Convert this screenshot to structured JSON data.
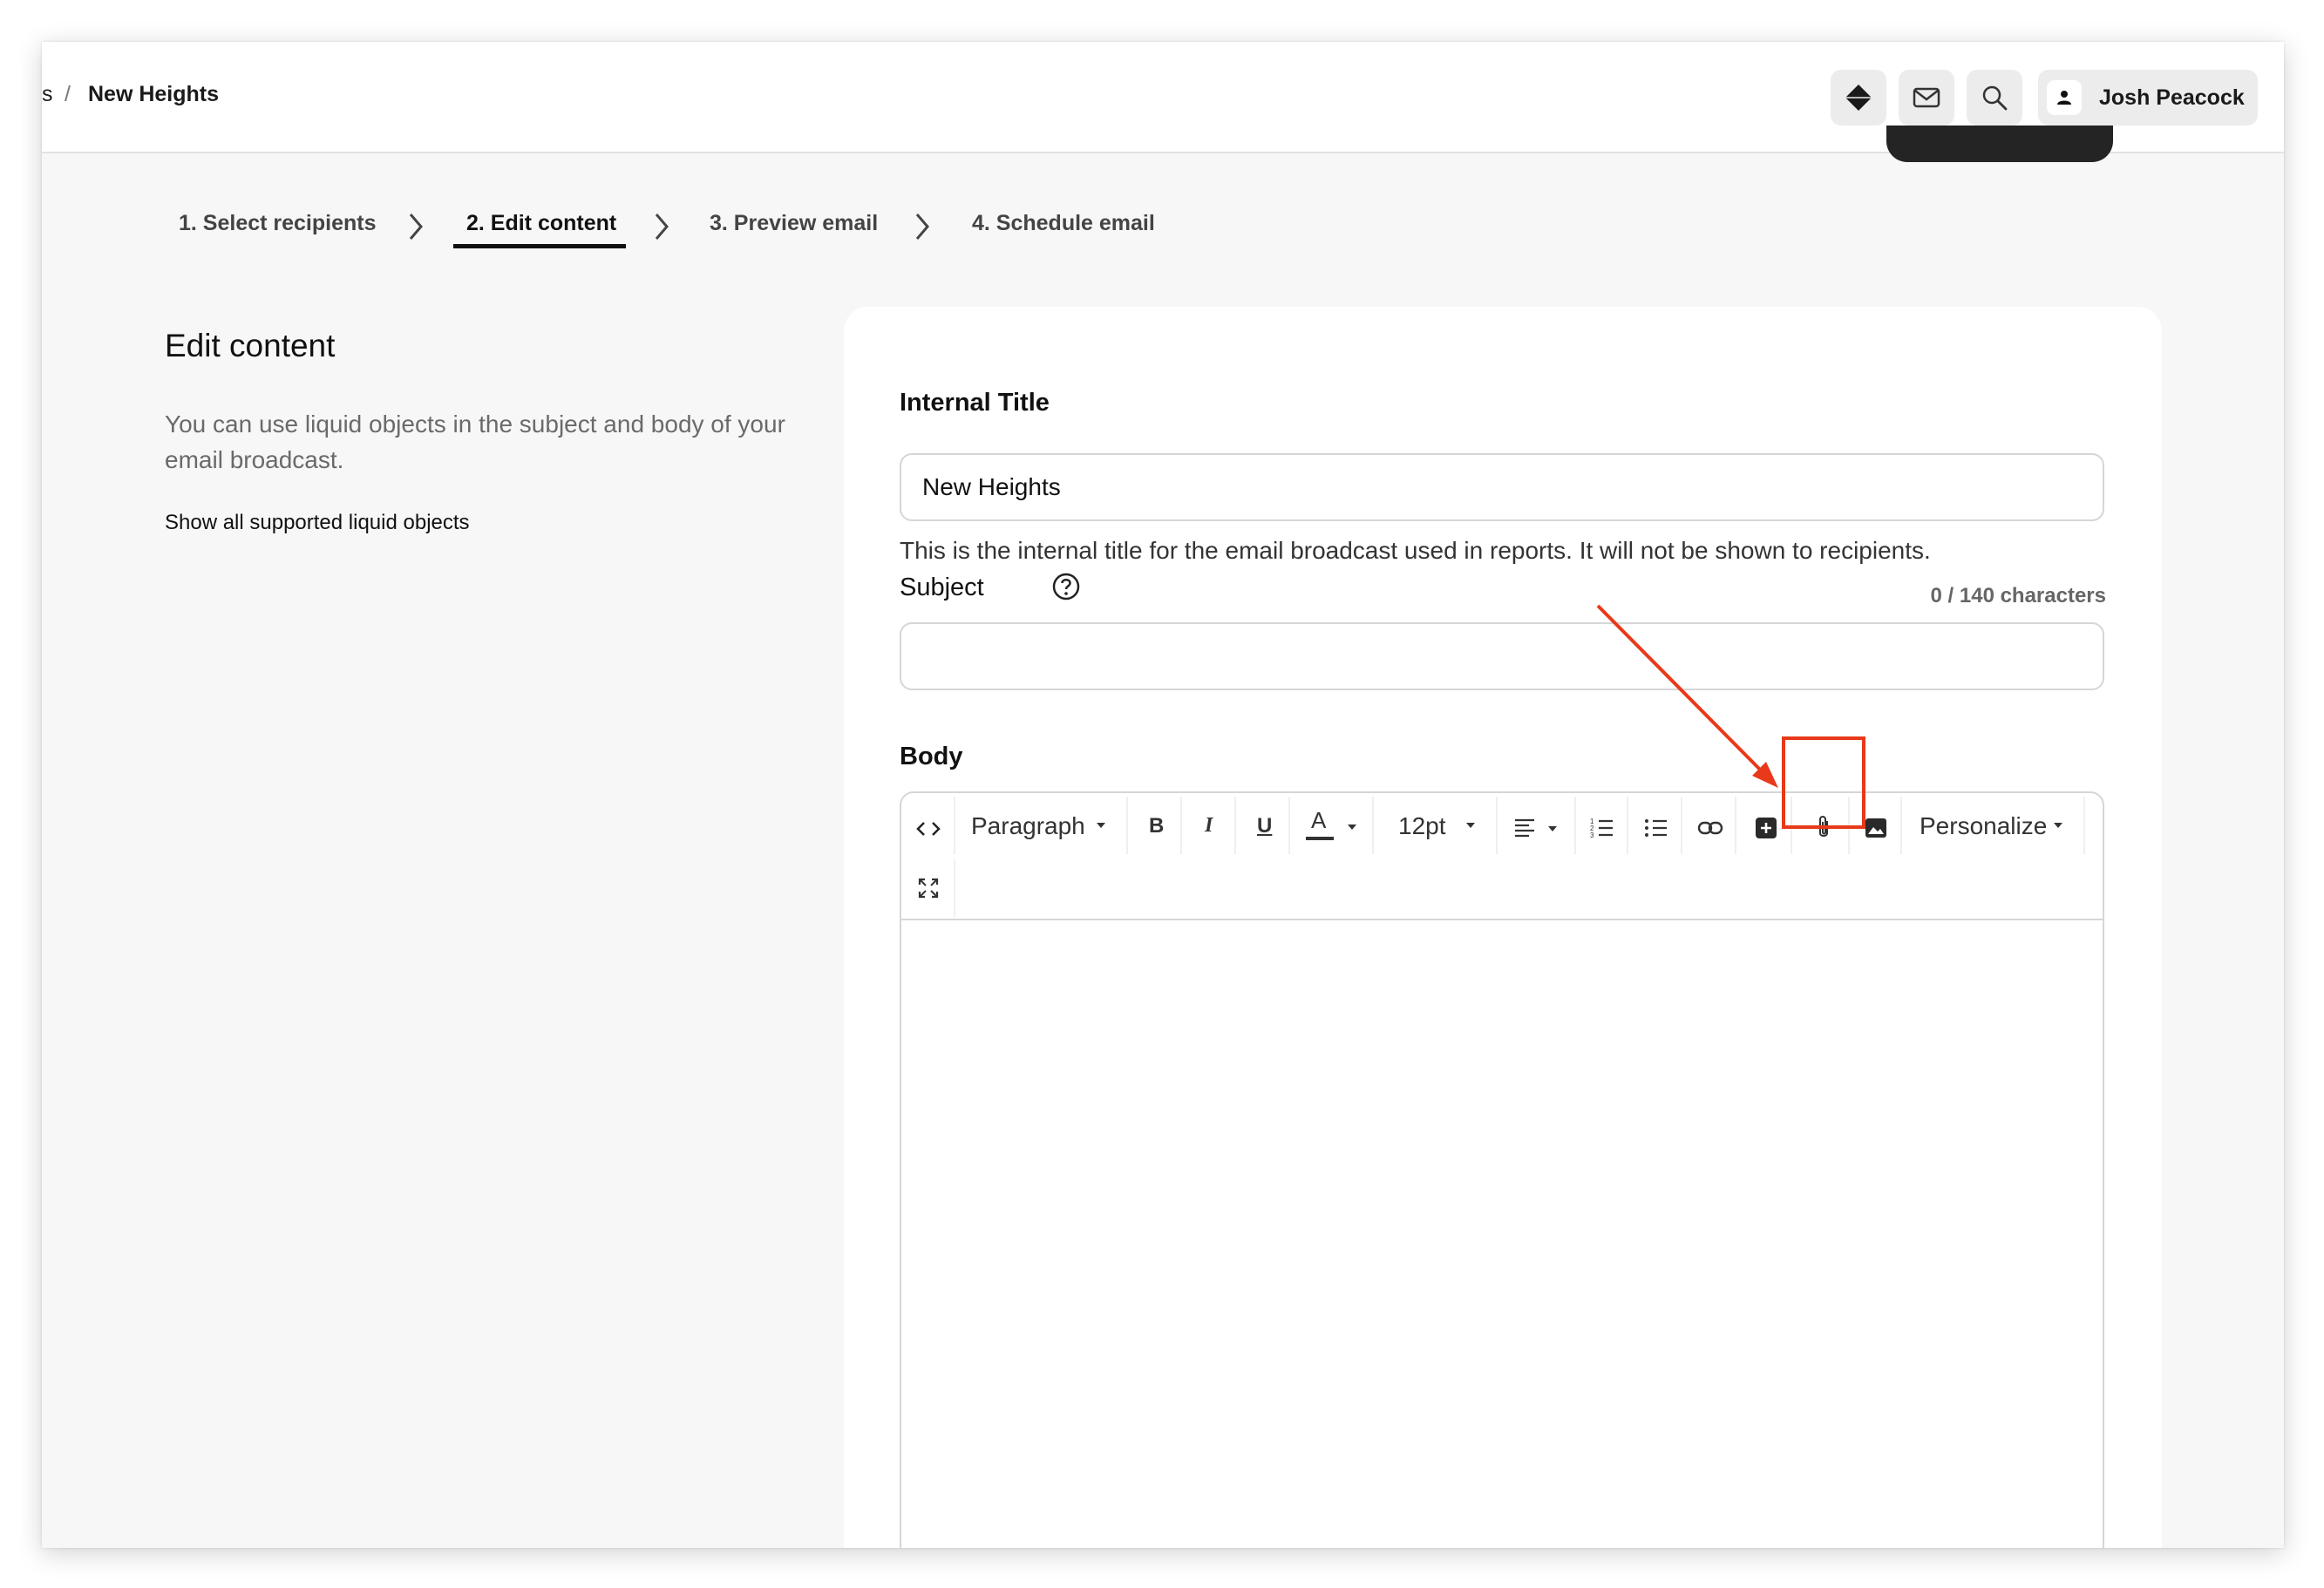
{
  "header": {
    "breadcrumb_partial": "s",
    "breadcrumb_separator": "/",
    "breadcrumb_title": "New Heights",
    "user_name": "Josh Peacock",
    "icons": [
      "diamond-icon",
      "mail-icon",
      "search-icon",
      "user-icon"
    ]
  },
  "steps": [
    {
      "label": "1. Select recipients",
      "active": false
    },
    {
      "label": "2. Edit content",
      "active": true
    },
    {
      "label": "3. Preview email",
      "active": false
    },
    {
      "label": "4. Schedule email",
      "active": false
    }
  ],
  "left": {
    "title": "Edit content",
    "description": "You can use liquid objects in the subject and body of your email broadcast.",
    "link": "Show all supported liquid objects"
  },
  "form": {
    "internal_title_label": "Internal Title",
    "internal_title_value": "New Heights",
    "internal_title_hint": "This is the internal title for the email broadcast used in reports. It will not be shown to recipients.",
    "subject_label": "Subject",
    "subject_value": "",
    "subject_count": "0 / 140 characters",
    "body_label": "Body"
  },
  "toolbar": {
    "paragraph": "Paragraph",
    "font_size": "12pt",
    "personalize": "Personalize",
    "bold": "B",
    "italic": "I",
    "underline": "U",
    "text_color": "A"
  },
  "colors": {
    "annotation": "#e8391a",
    "accent": "#111111",
    "page_background": "#f7f7f7"
  }
}
